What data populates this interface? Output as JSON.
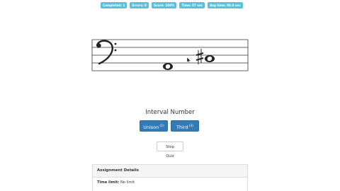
{
  "stats": {
    "completed": "Completed: 1",
    "errors": "Errors: 0",
    "score": "Score: 100%",
    "time": "Time: 07 sec",
    "avg_time": "Avg time: 00.0 sec"
  },
  "staff": {
    "clef": "bass-clef",
    "notes": [
      "whole-note",
      "sharp-whole-note"
    ]
  },
  "prompt": "Interval Number",
  "answers": [
    {
      "label": "Unison",
      "key": "(1)"
    },
    {
      "label": "Third",
      "key": "(3)"
    }
  ],
  "stop_label": "Stop Quiz",
  "assignment": {
    "heading": "Assignment Details",
    "time_limit_label": "Time limit:",
    "time_limit_value": "No limit"
  },
  "colors": {
    "badge": "#5bc0de",
    "primary": "#337ab7",
    "panel_heading_bg": "#f5f5f5"
  }
}
